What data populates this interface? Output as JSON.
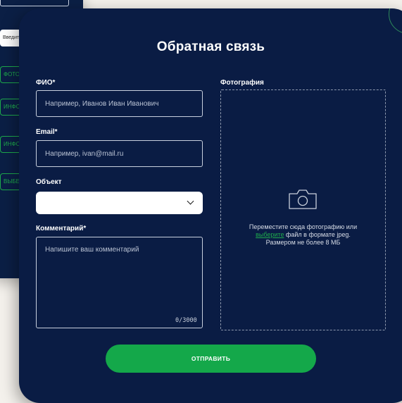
{
  "background_window": {
    "input_text": "Введите адрес объекта",
    "buttons": [
      "ФОТОГРАФИИ",
      "ИНФОРМАЦИЯ",
      "ИНФОРМАЦИЯ",
      "ВЫБЕРИТЕ ФАЙЛ"
    ]
  },
  "modal": {
    "title": "Обратная связь",
    "fio": {
      "label": "ФИО*",
      "placeholder": "Например, Иванов Иван Иванович",
      "value": ""
    },
    "email": {
      "label": "Email*",
      "placeholder": "Например, ivan@mail.ru",
      "value": ""
    },
    "object": {
      "label": "Объект",
      "selected": ""
    },
    "comment": {
      "label": "Комментарий*",
      "placeholder": "Напишите ваш комментарий",
      "value": "",
      "counter": "0/3000"
    },
    "photo": {
      "label": "Фотография",
      "line1": "Переместите сюда фотографию или",
      "link": "выберите",
      "line2_rest": " файл в формате jpeg.",
      "line3": "Размером не более 8 МБ",
      "icon": "camera-icon"
    },
    "submit_label": "ОТПРАВИТЬ"
  },
  "colors": {
    "modal_bg": "#0a1c44",
    "accent_green": "#14a84a",
    "page_bg": "#f4f1ec"
  }
}
